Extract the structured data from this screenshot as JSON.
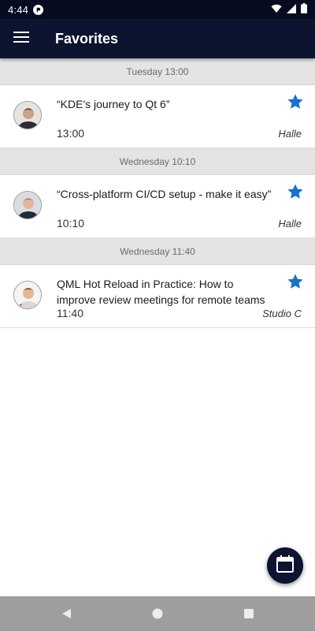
{
  "status_bar": {
    "time": "4:44",
    "icons": [
      "notification-icon",
      "wifi-icon",
      "signal-icon",
      "battery-icon"
    ]
  },
  "app_bar": {
    "title": "Favorites",
    "menu_icon": "menu-icon"
  },
  "colors": {
    "app_bar": "#0d1430",
    "status_bar": "#070b1f",
    "star": "#1773c9",
    "section_header": "#e4e4e4",
    "nav_bar": "#9e9e9e"
  },
  "sections": [
    {
      "header": "Tuesday 13:00",
      "items": [
        {
          "title": "“KDE's journey to Qt 6”",
          "time": "13:00",
          "room": "Halle",
          "favorite": true
        }
      ]
    },
    {
      "header": "Wednesday 10:10",
      "items": [
        {
          "title": "“Cross-platform CI/CD setup - make it easy”",
          "time": "10:10",
          "room": "Halle",
          "favorite": true
        }
      ]
    },
    {
      "header": "Wednesday 11:40",
      "items": [
        {
          "title": "QML Hot Reload in Practice: How to improve review meetings for remote teams",
          "time": "11:40",
          "room": "Studio C",
          "favorite": true
        }
      ]
    }
  ],
  "fab": {
    "icon": "calendar-icon"
  },
  "nav_bar": {
    "icons": [
      "back-icon",
      "home-icon",
      "recents-icon"
    ]
  }
}
